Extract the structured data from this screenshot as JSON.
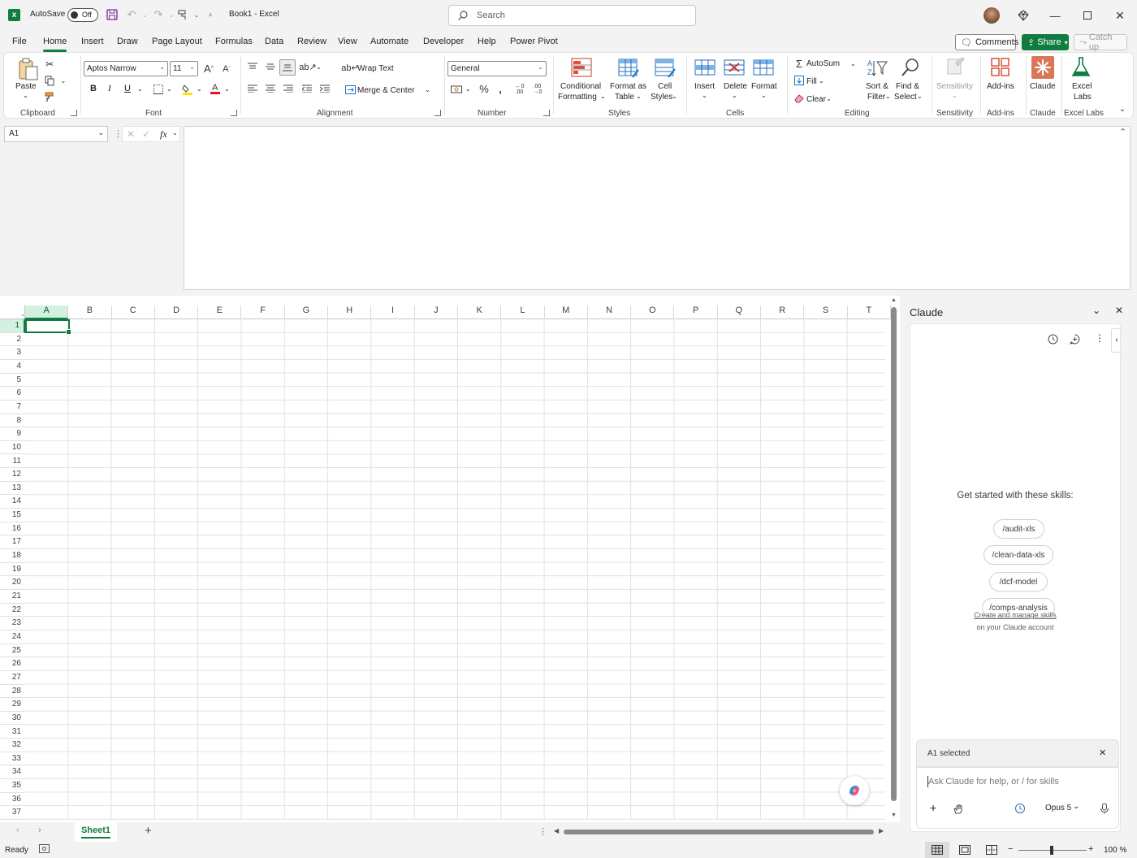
{
  "titlebar": {
    "autosave_label": "AutoSave",
    "autosave_state": "Off",
    "doc_title": "Book1  -  Excel",
    "search_placeholder": "Search"
  },
  "menu": {
    "tabs": [
      "File",
      "Home",
      "Insert",
      "Draw",
      "Page Layout",
      "Formulas",
      "Data",
      "Review",
      "View",
      "Automate",
      "Developer",
      "Help",
      "Power Pivot"
    ],
    "active_tab": "Home",
    "comments_label": "Comments",
    "share_label": "Share",
    "catchup_label": "Catch up"
  },
  "ribbon": {
    "groups": {
      "clipboard": "Clipboard",
      "font": "Font",
      "alignment": "Alignment",
      "number": "Number",
      "styles": "Styles",
      "cells": "Cells",
      "editing": "Editing",
      "sensitivity": "Sensitivity",
      "addins": "Add-ins",
      "claude": "Claude",
      "excel_labs": "Excel Labs"
    },
    "paste_label": "Paste",
    "font_name": "Aptos Narrow",
    "font_size": "11",
    "bold": "B",
    "italic": "I",
    "underline": "U",
    "wrap_text": "Wrap Text",
    "merge_center": "Merge & Center",
    "number_format": "General",
    "conditional_formatting_1": "Conditional",
    "conditional_formatting_2": "Formatting",
    "format_as_table_1": "Format as",
    "format_as_table_2": "Table",
    "cell_styles_1": "Cell",
    "cell_styles_2": "Styles",
    "insert": "Insert",
    "delete": "Delete",
    "format": "Format",
    "autosum": "AutoSum",
    "fill": "Fill",
    "clear": "Clear",
    "sort_filter_1": "Sort &",
    "sort_filter_2": "Filter",
    "find_select_1": "Find &",
    "find_select_2": "Select",
    "sensitivity": "Sensitivity",
    "addins": "Add-ins",
    "claude": "Claude",
    "excel_labs_1": "Excel",
    "excel_labs_2": "Labs"
  },
  "formula_bar": {
    "name_box": "A1",
    "fx": "fx",
    "formula": ""
  },
  "grid": {
    "columns": [
      "A",
      "B",
      "C",
      "D",
      "E",
      "F",
      "G",
      "H",
      "I",
      "J",
      "K",
      "L",
      "M",
      "N",
      "O",
      "P",
      "Q",
      "R",
      "S",
      "T"
    ],
    "rows": [
      "1",
      "2",
      "3",
      "4",
      "5",
      "6",
      "7",
      "8",
      "9",
      "10",
      "11",
      "12",
      "13",
      "14",
      "15",
      "16",
      "17",
      "18",
      "19",
      "20",
      "21",
      "22",
      "23",
      "24",
      "25",
      "26",
      "27",
      "28",
      "29",
      "30",
      "31",
      "32",
      "33",
      "34",
      "35",
      "36",
      "37"
    ],
    "selected_cell": "A1"
  },
  "sheets": {
    "tabs": [
      "Sheet1"
    ],
    "active": "Sheet1"
  },
  "status": {
    "ready": "Ready",
    "zoom": "100 %"
  },
  "claude_panel": {
    "title": "Claude",
    "skills_heading": "Get started with these skills:",
    "skills": [
      "/audit-xls",
      "/clean-data-xls",
      "/dcf-model",
      "/comps-analysis"
    ],
    "manage_link": "Create and manage skills",
    "manage_sub": "on your Claude account",
    "selection_label": "A1 selected",
    "input_placeholder": "Ask Claude for help, or / for skills",
    "model": "Opus 5"
  },
  "colors": {
    "accent": "#107c41",
    "selected_header_bg": "#d3f0e0"
  }
}
